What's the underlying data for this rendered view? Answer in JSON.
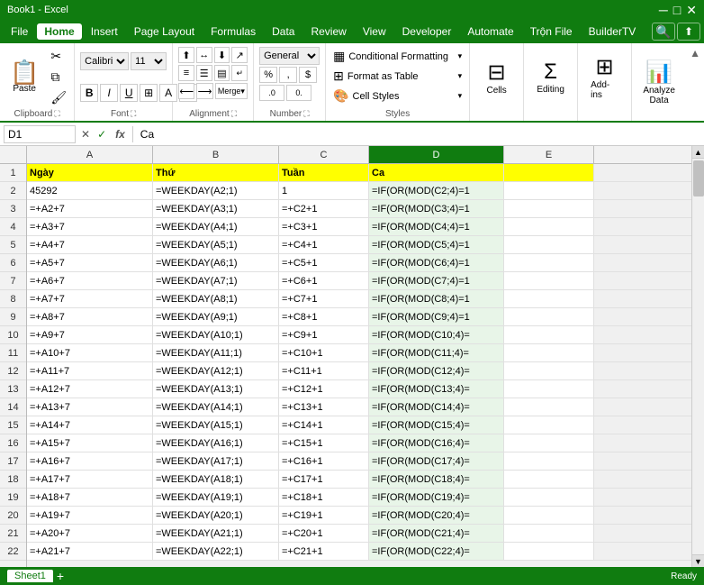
{
  "titlebar": {
    "title": "Book1 - Excel"
  },
  "menubar": {
    "items": [
      {
        "label": "File",
        "active": false
      },
      {
        "label": "Home",
        "active": true
      },
      {
        "label": "Insert",
        "active": false
      },
      {
        "label": "Page Layout",
        "active": false
      },
      {
        "label": "Formulas",
        "active": false
      },
      {
        "label": "Data",
        "active": false
      },
      {
        "label": "Review",
        "active": false
      },
      {
        "label": "View",
        "active": false
      },
      {
        "label": "Developer",
        "active": false
      },
      {
        "label": "Automate",
        "active": false
      },
      {
        "label": "Trộn File",
        "active": false
      },
      {
        "label": "BuilderTV",
        "active": false
      }
    ]
  },
  "ribbon": {
    "groups": {
      "clipboard": {
        "label": "Clipboard",
        "paste": "Paste",
        "cut": "✂",
        "copy": "⧉",
        "format_painter": "🖌"
      },
      "font": {
        "label": "Font"
      },
      "alignment": {
        "label": "Alignment"
      },
      "number": {
        "label": "Number"
      },
      "styles": {
        "label": "Styles",
        "conditional_formatting": "Conditional Formatting",
        "format_table": "Format as Table",
        "cell_styles": "Cell Styles"
      },
      "cells": {
        "label": "Cells"
      },
      "editing": {
        "label": "Editing"
      },
      "addins": {
        "label": "Add-ins"
      },
      "analyze": {
        "label": "Analyze Data"
      }
    }
  },
  "formulabar": {
    "namebox": "D1",
    "formula": "Ca",
    "cancel": "✕",
    "confirm": "✓",
    "fx": "fx"
  },
  "columns": [
    {
      "label": "A",
      "key": "col-a"
    },
    {
      "label": "B",
      "key": "col-b"
    },
    {
      "label": "C",
      "key": "col-c"
    },
    {
      "label": "D",
      "key": "col-d",
      "selected": true
    },
    {
      "label": "E",
      "key": "col-e"
    }
  ],
  "rows": [
    {
      "num": 1,
      "cells": [
        "Ngày",
        "Thứ",
        "Tuần",
        "Ca",
        ""
      ],
      "header": true
    },
    {
      "num": 2,
      "cells": [
        "45292",
        "=WEEKDAY(A2;1)",
        "1",
        "=IF(OR(MOD(C2;4)=1",
        ""
      ]
    },
    {
      "num": 3,
      "cells": [
        "=+A2+7",
        "=WEEKDAY(A3;1)",
        "=+C2+1",
        "=IF(OR(MOD(C3;4)=1",
        ""
      ]
    },
    {
      "num": 4,
      "cells": [
        "=+A3+7",
        "=WEEKDAY(A4;1)",
        "=+C3+1",
        "=IF(OR(MOD(C4;4)=1",
        ""
      ]
    },
    {
      "num": 5,
      "cells": [
        "=+A4+7",
        "=WEEKDAY(A5;1)",
        "=+C4+1",
        "=IF(OR(MOD(C5;4)=1",
        ""
      ]
    },
    {
      "num": 6,
      "cells": [
        "=+A5+7",
        "=WEEKDAY(A6;1)",
        "=+C5+1",
        "=IF(OR(MOD(C6;4)=1",
        ""
      ]
    },
    {
      "num": 7,
      "cells": [
        "=+A6+7",
        "=WEEKDAY(A7;1)",
        "=+C6+1",
        "=IF(OR(MOD(C7;4)=1",
        ""
      ]
    },
    {
      "num": 8,
      "cells": [
        "=+A7+7",
        "=WEEKDAY(A8;1)",
        "=+C7+1",
        "=IF(OR(MOD(C8;4)=1",
        ""
      ]
    },
    {
      "num": 9,
      "cells": [
        "=+A8+7",
        "=WEEKDAY(A9;1)",
        "=+C8+1",
        "=IF(OR(MOD(C9;4)=1",
        ""
      ]
    },
    {
      "num": 10,
      "cells": [
        "=+A9+7",
        "=WEEKDAY(A10;1)",
        "=+C9+1",
        "=IF(OR(MOD(C10;4)=",
        ""
      ]
    },
    {
      "num": 11,
      "cells": [
        "=+A10+7",
        "=WEEKDAY(A11;1)",
        "=+C10+1",
        "=IF(OR(MOD(C11;4)=",
        ""
      ]
    },
    {
      "num": 12,
      "cells": [
        "=+A11+7",
        "=WEEKDAY(A12;1)",
        "=+C11+1",
        "=IF(OR(MOD(C12;4)=",
        ""
      ]
    },
    {
      "num": 13,
      "cells": [
        "=+A12+7",
        "=WEEKDAY(A13;1)",
        "=+C12+1",
        "=IF(OR(MOD(C13;4)=",
        ""
      ]
    },
    {
      "num": 14,
      "cells": [
        "=+A13+7",
        "=WEEKDAY(A14;1)",
        "=+C13+1",
        "=IF(OR(MOD(C14;4)=",
        ""
      ]
    },
    {
      "num": 15,
      "cells": [
        "=+A14+7",
        "=WEEKDAY(A15;1)",
        "=+C14+1",
        "=IF(OR(MOD(C15;4)=",
        ""
      ]
    },
    {
      "num": 16,
      "cells": [
        "=+A15+7",
        "=WEEKDAY(A16;1)",
        "=+C15+1",
        "=IF(OR(MOD(C16;4)=",
        ""
      ]
    },
    {
      "num": 17,
      "cells": [
        "=+A16+7",
        "=WEEKDAY(A17;1)",
        "=+C16+1",
        "=IF(OR(MOD(C17;4)=",
        ""
      ]
    },
    {
      "num": 18,
      "cells": [
        "=+A17+7",
        "=WEEKDAY(A18;1)",
        "=+C17+1",
        "=IF(OR(MOD(C18;4)=",
        ""
      ]
    },
    {
      "num": 19,
      "cells": [
        "=+A18+7",
        "=WEEKDAY(A19;1)",
        "=+C18+1",
        "=IF(OR(MOD(C19;4)=",
        ""
      ]
    },
    {
      "num": 20,
      "cells": [
        "=+A19+7",
        "=WEEKDAY(A20;1)",
        "=+C19+1",
        "=IF(OR(MOD(C20;4)=",
        ""
      ]
    },
    {
      "num": 21,
      "cells": [
        "=+A20+7",
        "=WEEKDAY(A21;1)",
        "=+C20+1",
        "=IF(OR(MOD(C21;4)=",
        ""
      ]
    },
    {
      "num": 22,
      "cells": [
        "=+A21+7",
        "=WEEKDAY(A22;1)",
        "=+C21+1",
        "=IF(OR(MOD(C22;4)=",
        ""
      ]
    }
  ],
  "colors": {
    "green": "#107c10",
    "yellow": "#ffff00",
    "light_green_hover": "#e8f5e8"
  }
}
